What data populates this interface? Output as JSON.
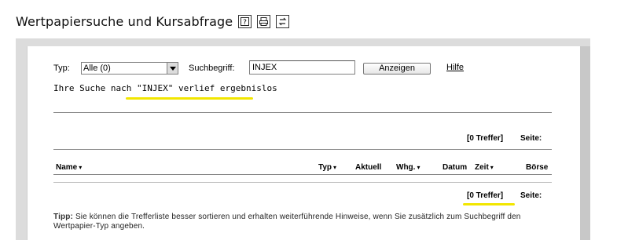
{
  "header": {
    "title": "Wertpapiersuche und Kursabfrage",
    "icons": [
      "help-icon",
      "print-icon",
      "refresh-icon"
    ]
  },
  "form": {
    "typ_label": "Typ:",
    "typ_value": "Alle (0)",
    "search_label": "Suchbegriff:",
    "search_value": "INJEX",
    "show_button": "Anzeigen",
    "help_link": "Hilfe"
  },
  "result_message": "Ihre Suche nach \"INJEX\" verlief ergebnislos",
  "paging_top": {
    "hits": "[0 Treffer]",
    "page_label": "Seite:"
  },
  "table": {
    "columns": [
      "Name",
      "Typ",
      "Aktuell",
      "Whg.",
      "Datum",
      "Zeit",
      "Börse"
    ]
  },
  "paging_bottom": {
    "hits": "[0 Treffer]",
    "page_label": "Seite:"
  },
  "tip": {
    "prefix": "Tipp:",
    "text": "Sie können die Trefferliste besser sortieren und erhalten weiterführende Hinweise, wenn Sie zusätzlich zum Suchbegriff den Wertpapier-Typ angeben."
  },
  "colors": {
    "highlight": "#f2e600",
    "panel_border": "#dcdcdc"
  }
}
